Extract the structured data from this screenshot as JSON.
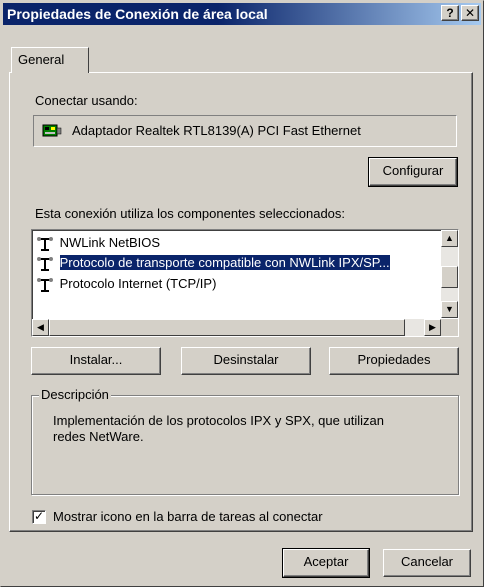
{
  "window": {
    "title": "Propiedades de Conexión de área local",
    "help_button": "?",
    "close_button": "✕"
  },
  "tabs": [
    {
      "label": "General"
    }
  ],
  "connect_using": {
    "label": "Conectar usando:",
    "adapter": "Adaptador Realtek RTL8139(A) PCI Fast Ethernet",
    "configure_button": "Configurar"
  },
  "components": {
    "label": "Esta conexión utiliza los componentes seleccionados:",
    "items": [
      {
        "label": "NWLink NetBIOS",
        "selected": false
      },
      {
        "label": "Protocolo de transporte compatible con NWLink IPX/SP...",
        "selected": true
      },
      {
        "label": "Protocolo Internet (TCP/IP)",
        "selected": false
      }
    ]
  },
  "actions": {
    "install": "Instalar...",
    "uninstall": "Desinstalar",
    "properties": "Propiedades"
  },
  "description": {
    "legend": "Descripción",
    "text_line1": "Implementación de los protocolos IPX y SPX, que utilizan",
    "text_line2": "redes NetWare."
  },
  "show_icon": {
    "label": "Mostrar icono en la barra de tareas al conectar",
    "checked": true
  },
  "footer": {
    "ok": "Aceptar",
    "cancel": "Cancelar"
  }
}
